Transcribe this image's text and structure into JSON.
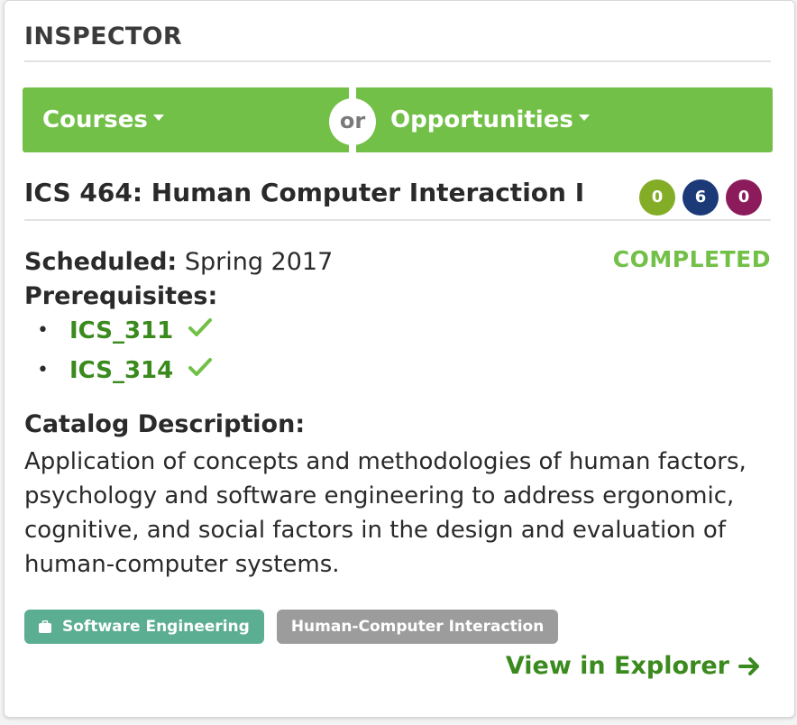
{
  "header": {
    "title": "INSPECTOR"
  },
  "menu": {
    "courses_label": "Courses",
    "or_label": "or",
    "opportunities_label": "Opportunities"
  },
  "course": {
    "title": "ICS 464: Human Computer Interaction I",
    "badges": [
      {
        "value": "0",
        "color": "#84ad27"
      },
      {
        "value": "6",
        "color": "#1c3a78"
      },
      {
        "value": "0",
        "color": "#8c1b5b"
      }
    ],
    "status": "COMPLETED",
    "scheduled_label": "Scheduled:",
    "scheduled_value": "Spring 2017",
    "prereq_label": "Prerequisites:",
    "prerequisites": [
      "ICS_311",
      "ICS_314"
    ],
    "catalog_label": "Catalog Description:",
    "catalog_text": "Application of concepts and methodologies of human factors, psychology and software engineering to address ergonomic, cognitive, and social factors in the design and evaluation of human-computer systems.",
    "tags": [
      {
        "label": "Software Engineering",
        "icon": "briefcase-icon"
      },
      {
        "label": "Human-Computer Interaction"
      }
    ],
    "explorer_label": "View in Explorer"
  },
  "colors": {
    "accent_green": "#72c048",
    "link_green": "#3a8a1e",
    "tag_green": "#5cae92",
    "tag_gray": "#9c9c9c"
  }
}
